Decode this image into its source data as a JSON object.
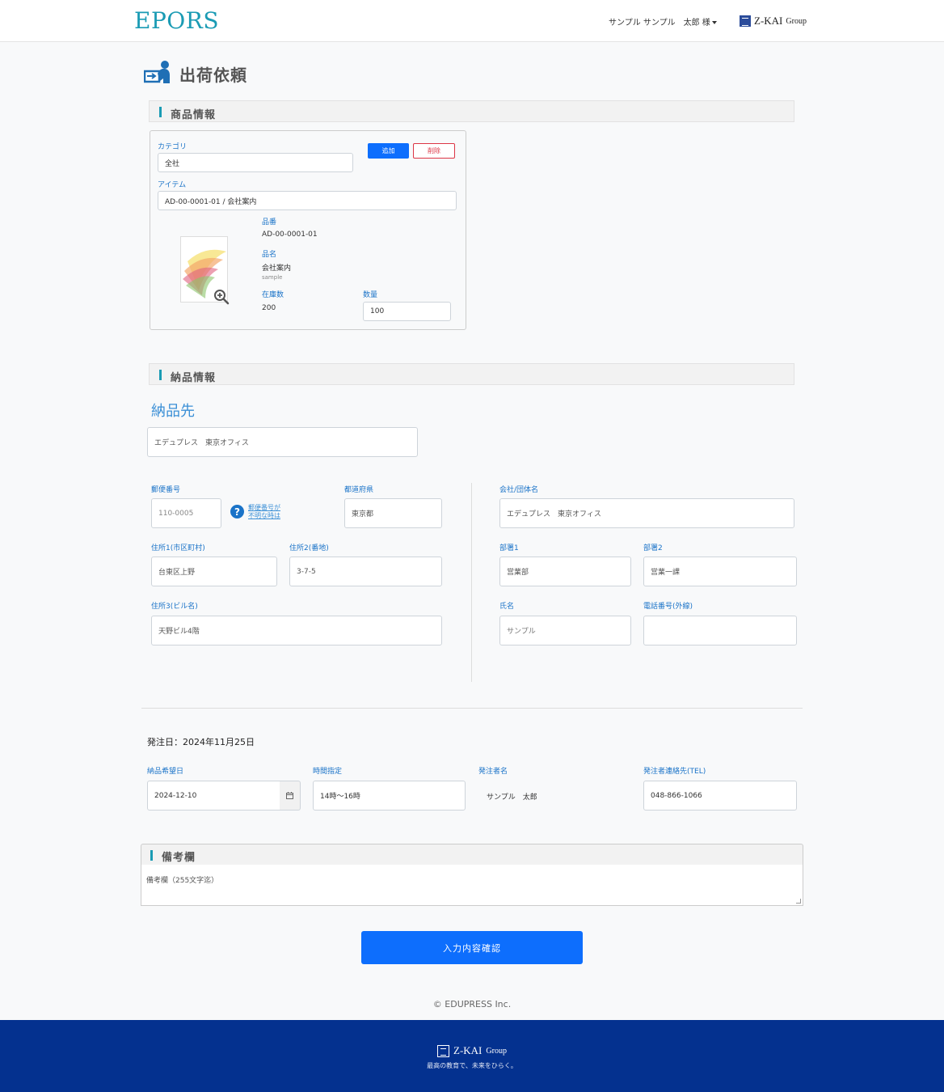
{
  "header": {
    "logo": "EPORS",
    "user": "サンプル サンプル　太郎 様",
    "brand_main": "Z-KAI",
    "brand_sub": "Group"
  },
  "page": {
    "title": "出荷依頼"
  },
  "product_section": {
    "title": "商品情報",
    "category_label": "カテゴリ",
    "category_value": "全社",
    "add_button": "追加",
    "delete_button": "削除",
    "item_label": "アイテム",
    "item_value": "AD-00-0001-01 / 会社案内",
    "part_no_label": "品番",
    "part_no_value": "AD-00-0001-01",
    "name_label": "品名",
    "name_value": "会社案内",
    "name_note": "sample",
    "stock_label": "在庫数",
    "stock_value": "200",
    "qty_label": "数量",
    "qty_value": "100"
  },
  "delivery_section": {
    "title": "納品情報",
    "dest_heading": "納品先",
    "dest_value": "エデュプレス　東京オフィス",
    "zip_label": "郵便番号",
    "zip_placeholder": "110-0005",
    "zip_help_line1": "郵便番号が",
    "zip_help_line2": "不明な時は",
    "pref_label": "都道府県",
    "pref_value": "東京都",
    "addr1_label": "住所1(市区町村)",
    "addr1_value": "台東区上野",
    "addr2_label": "住所2(番地)",
    "addr2_value": "3-7-5",
    "addr3_label": "住所3(ビル名)",
    "addr3_value": "天野ビル4階",
    "company_label": "会社/団体名",
    "company_value": "エデュプレス　東京オフィス",
    "dept1_label": "部署1",
    "dept1_value": "営業部",
    "dept2_label": "部署2",
    "dept2_value": "営業一課",
    "person_label": "氏名",
    "person_value": "サンプル",
    "tel_label": "電話番号(外線)",
    "tel_value": ""
  },
  "order": {
    "order_date": "発注日：2024年11月25日",
    "desired_date_label": "納品希望日",
    "desired_date_value": "2024-12-10",
    "time_label": "時間指定",
    "time_value": "14時〜16時",
    "orderer_label": "発注者名",
    "orderer_value": "サンプル　太郎",
    "orderer_tel_label": "発注者連絡先(TEL)",
    "orderer_tel_value": "048-866-1066"
  },
  "remarks": {
    "title": "備考欄",
    "placeholder": "備考欄（255文字迄）"
  },
  "submit_button": "入力内容確認",
  "copyright": "© EDUPRESS Inc.",
  "footer": {
    "brand_main": "Z-KAI",
    "brand_sub": "Group",
    "tagline": "最高の教育で、未来をひらく。"
  }
}
